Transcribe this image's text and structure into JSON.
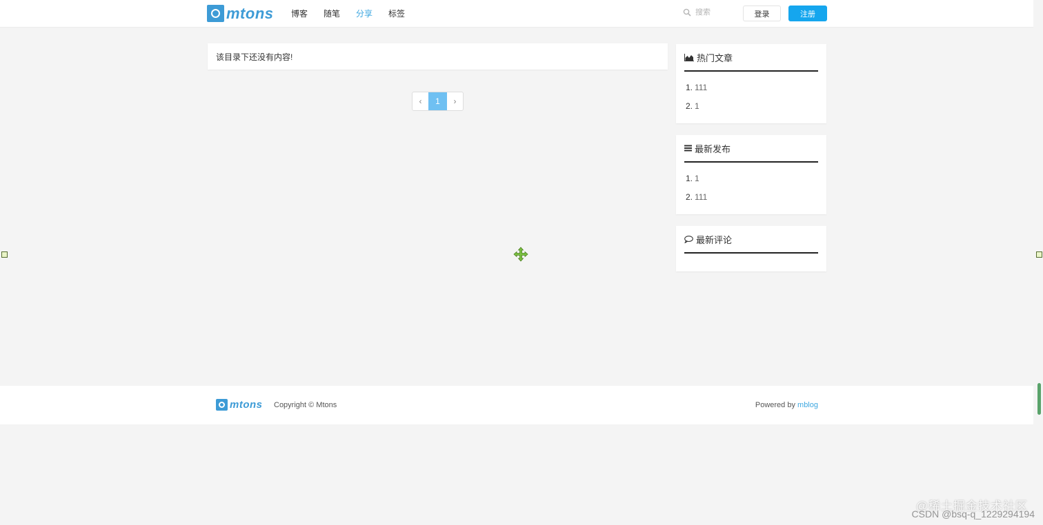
{
  "header": {
    "logo_text": "mtons",
    "nav": [
      {
        "label": "博客",
        "active": false
      },
      {
        "label": "随笔",
        "active": false
      },
      {
        "label": "分享",
        "active": true
      },
      {
        "label": "标签",
        "active": false
      }
    ],
    "search_placeholder": "搜索",
    "login_label": "登录",
    "register_label": "注册"
  },
  "main": {
    "empty_message": "该目录下还没有内容!",
    "pagination": {
      "prev": "‹",
      "current": "1",
      "next": "›"
    }
  },
  "sidebar": {
    "hot": {
      "title": "热门文章",
      "icon": "area-chart-icon",
      "items": [
        {
          "num": "1.",
          "label": "111"
        },
        {
          "num": "2.",
          "label": "1"
        }
      ]
    },
    "latest": {
      "title": "最新发布",
      "icon": "list-icon",
      "items": [
        {
          "num": "1.",
          "label": "1"
        },
        {
          "num": "2.",
          "label": "111"
        }
      ]
    },
    "comments": {
      "title": "最新评论",
      "icon": "comment-icon"
    }
  },
  "footer": {
    "logo_text": "mtons",
    "copyright": "Copyright © Mtons",
    "powered_prefix": "Powered by",
    "powered_link": "mblog"
  },
  "watermark": {
    "line1": "@稀土掘金技术社区",
    "line2": "CSDN @bsq-q_1229294194"
  },
  "colors": {
    "accent": "#15a6ee",
    "brand": "#3d9bd6",
    "active_nav": "#3da7e0"
  }
}
